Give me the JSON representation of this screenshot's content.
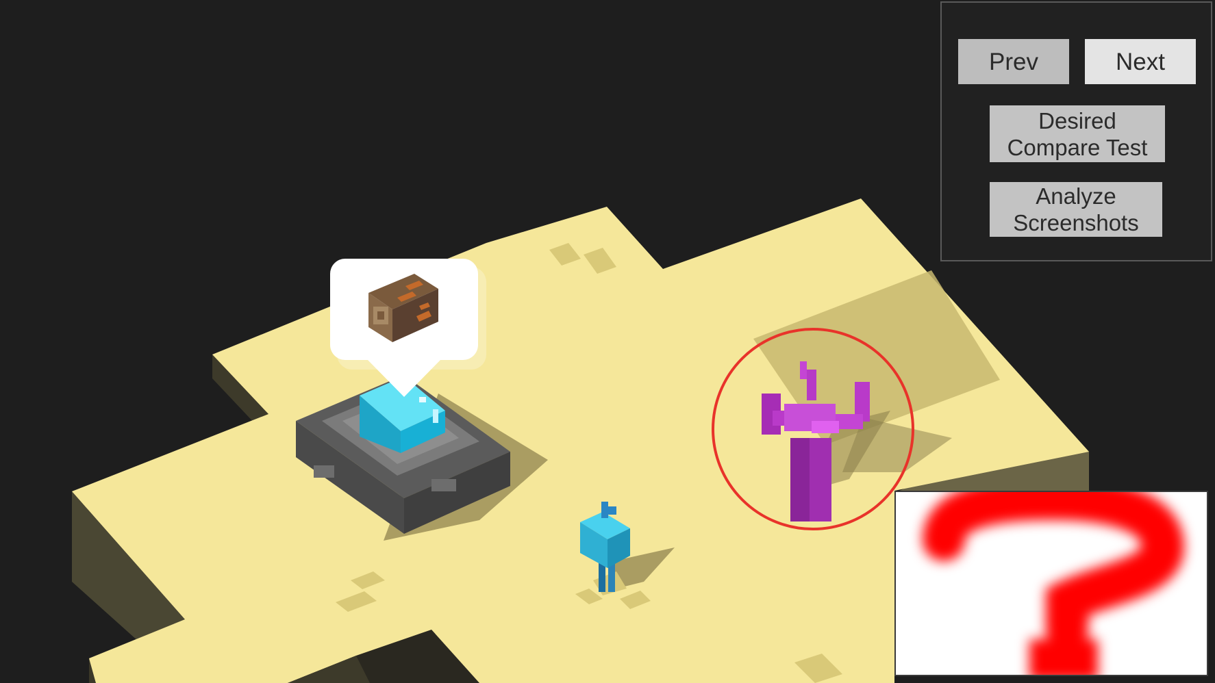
{
  "buttons": {
    "prev_label": "Prev",
    "next_label": "Next",
    "compare_label": "Desired\nCompare Test",
    "analyze_label": "Analyze\nScreenshots"
  },
  "scene": {
    "ground_color": "#f5e79a",
    "background_color": "#1e1e1e",
    "player_color": "#33c1e0",
    "cactus_color": "#c03ad0",
    "highlight_ring_color": "#e8332a",
    "speech_bubble_icon": "log-icon",
    "preview_icon": "question-mark-icon"
  }
}
